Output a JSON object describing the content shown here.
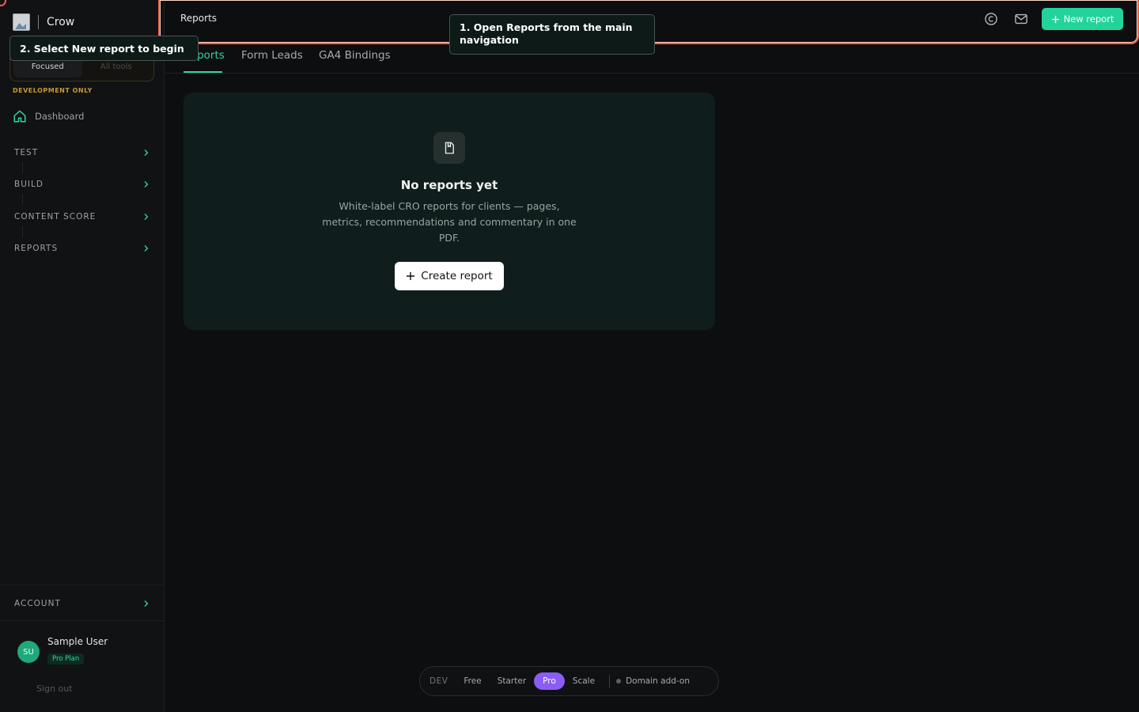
{
  "brand": {
    "name": "Crow"
  },
  "sidebar": {
    "modes": [
      "Focused",
      "All tools"
    ],
    "dev_label": "DEVELOPMENT ONLY",
    "dashboard": "Dashboard",
    "groups": [
      "TEST",
      "BUILD",
      "CONTENT SCORE",
      "REPORTS"
    ],
    "account": "ACCOUNT",
    "user": {
      "initials": "SU",
      "name": "Sample User",
      "plan": "Pro Plan"
    },
    "sign_out": "Sign out"
  },
  "header": {
    "title": "Reports",
    "new_report": "New report"
  },
  "tabs": [
    "Reports",
    "Form Leads",
    "GA4 Bindings"
  ],
  "empty_state": {
    "title": "No reports yet",
    "description": "White-label CRO reports for clients — pages, metrics, recommendations and commentary in one PDF.",
    "button": "Create report"
  },
  "tooltips": {
    "step1": "1. Open Reports from the main navigation",
    "step2": "2. Select New report to begin"
  },
  "plan_bar": {
    "dev": "DEV",
    "plans": [
      "Free",
      "Starter",
      "Pro",
      "Scale"
    ],
    "active": "Pro",
    "addon": "Domain add-on"
  },
  "colors": {
    "accent": "#22d39a",
    "highlight": "#f0603f",
    "pro": "#8b5cf6"
  }
}
